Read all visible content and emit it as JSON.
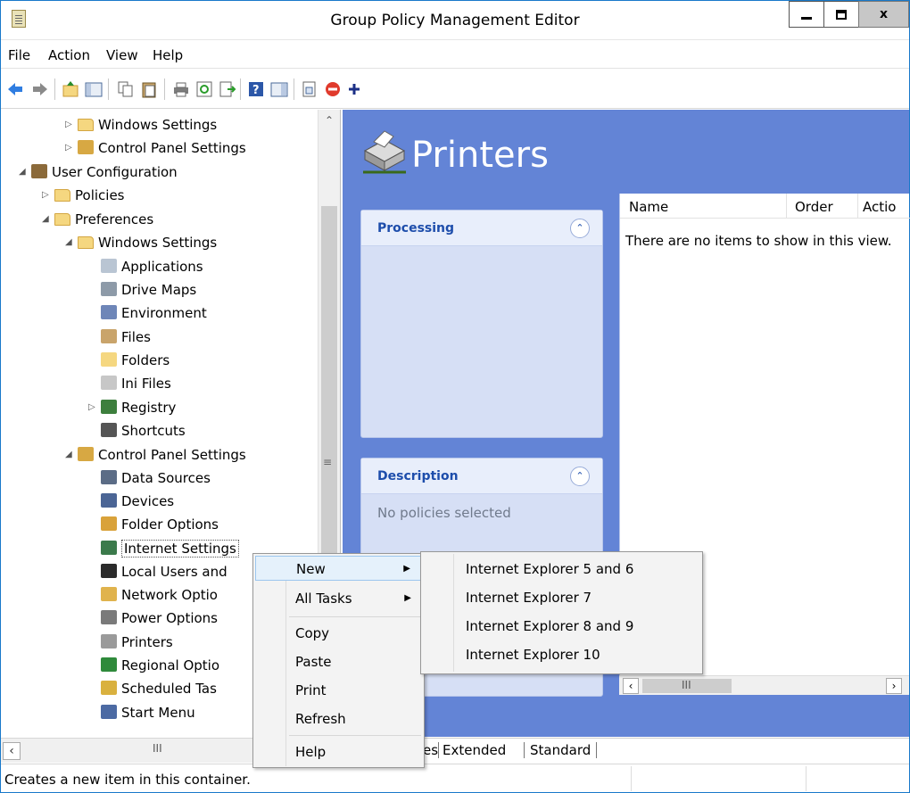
{
  "window": {
    "title": "Group Policy Management Editor",
    "accent": "#1979ca"
  },
  "menubar": {
    "items": [
      "File",
      "Action",
      "View",
      "Help"
    ]
  },
  "toolbar": {
    "icons": [
      "back-icon",
      "forward-icon",
      "up-folder-icon",
      "show-hide-tree-icon",
      "copy-icon",
      "paste-icon",
      "print-icon",
      "refresh-icon",
      "export-list-icon",
      "help-icon",
      "show-hide-action-pane-icon",
      "properties-icon",
      "stop-icon",
      "add-icon"
    ]
  },
  "tree": {
    "items": [
      {
        "label": "Windows Settings",
        "twisty": "▷",
        "icon": "folder-icon"
      },
      {
        "label": "Control Panel Settings",
        "twisty": "▷",
        "icon": "control-panel-icon"
      },
      {
        "label": "User Configuration",
        "twisty": "◢",
        "icon": "users-icon"
      },
      {
        "label": "Policies",
        "twisty": "▷",
        "icon": "folder-icon"
      },
      {
        "label": "Preferences",
        "twisty": "◢",
        "icon": "folder-icon"
      },
      {
        "label": "Windows Settings",
        "twisty": "◢",
        "icon": "folder-icon"
      },
      {
        "label": "Applications",
        "twisty": "",
        "icon": "applications-icon"
      },
      {
        "label": "Drive Maps",
        "twisty": "",
        "icon": "drive-maps-icon"
      },
      {
        "label": "Environment",
        "twisty": "",
        "icon": "environment-icon"
      },
      {
        "label": "Files",
        "twisty": "",
        "icon": "files-icon"
      },
      {
        "label": "Folders",
        "twisty": "",
        "icon": "folders-icon"
      },
      {
        "label": "Ini Files",
        "twisty": "",
        "icon": "ini-files-icon"
      },
      {
        "label": "Registry",
        "twisty": "▷",
        "icon": "registry-icon"
      },
      {
        "label": "Shortcuts",
        "twisty": "",
        "icon": "shortcuts-icon"
      },
      {
        "label": "Control Panel Settings",
        "twisty": "◢",
        "icon": "control-panel-icon"
      },
      {
        "label": "Data Sources",
        "twisty": "",
        "icon": "data-sources-icon"
      },
      {
        "label": "Devices",
        "twisty": "",
        "icon": "devices-icon"
      },
      {
        "label": "Folder Options",
        "twisty": "",
        "icon": "folder-options-icon"
      },
      {
        "label": "Internet Settings",
        "twisty": "",
        "icon": "internet-settings-icon"
      },
      {
        "label": "Local Users and",
        "twisty": "",
        "icon": "local-users-icon"
      },
      {
        "label": "Network Optio",
        "twisty": "",
        "icon": "network-options-icon"
      },
      {
        "label": "Power Options",
        "twisty": "",
        "icon": "power-options-icon"
      },
      {
        "label": "Printers",
        "twisty": "",
        "icon": "printers-icon"
      },
      {
        "label": "Regional Optio",
        "twisty": "",
        "icon": "regional-options-icon"
      },
      {
        "label": "Scheduled Tas",
        "twisty": "",
        "icon": "scheduled-tasks-icon"
      },
      {
        "label": "Start Menu",
        "twisty": "",
        "icon": "start-menu-icon"
      }
    ],
    "hscroll_grip": "III"
  },
  "pane": {
    "title": "Printers",
    "processing": {
      "label": "Processing",
      "collapse_glyph": "⌃"
    },
    "description": {
      "label": "Description",
      "text": "No policies selected",
      "collapse_glyph": "⌃"
    }
  },
  "listview": {
    "columns": [
      "Name",
      "Order",
      "Actio"
    ],
    "empty_text": "There are no items to show in this view.",
    "hscroll_grip": "III"
  },
  "tabs": {
    "items": [
      "es",
      "Extended",
      "Standard"
    ]
  },
  "status": {
    "text": "Creates a new item in this container."
  },
  "context_menu": {
    "items": [
      "New",
      "All Tasks",
      "Copy",
      "Paste",
      "Print",
      "Refresh",
      "Help"
    ],
    "submenu_arrow": "▶"
  },
  "submenu": {
    "items": [
      "Internet Explorer 5 and 6",
      "Internet Explorer 7",
      "Internet Explorer 8 and 9",
      "Internet Explorer 10"
    ]
  }
}
